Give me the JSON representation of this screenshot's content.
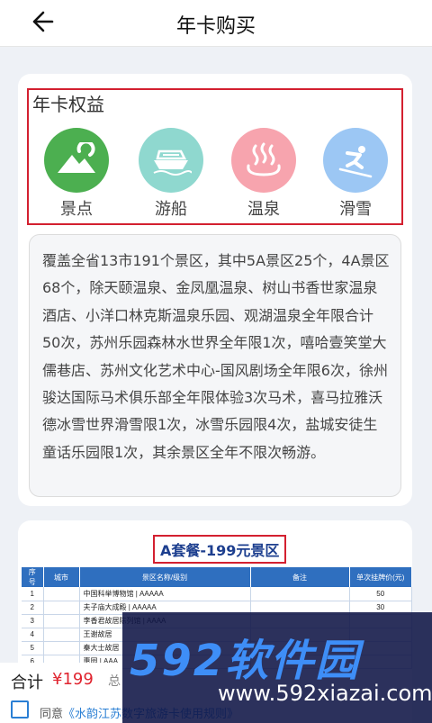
{
  "header": {
    "title": "年卡购买"
  },
  "benefits": {
    "title": "年卡权益",
    "items": [
      {
        "label": "景点",
        "icon": "mountain-icon",
        "color": "#4caf50"
      },
      {
        "label": "游船",
        "icon": "ship-icon",
        "color": "#8fd8cf"
      },
      {
        "label": "温泉",
        "icon": "hot-spring-icon",
        "color": "#f7a4ae"
      },
      {
        "label": "滑雪",
        "icon": "skiing-icon",
        "color": "#9cc7f4"
      }
    ],
    "description": "覆盖全省13市191个景区，其中5A景区25个，4A景区68个，除天颐温泉、金凤凰温泉、树山书香世家温泉酒店、小洋口林克斯温泉乐园、观湖温泉全年限合计50次，苏州乐园森林水世界全年限1次，嘻哈壹笑堂大儒巷店、苏州文化艺术中心-国风剧场全年限6次，徐州骏达国际马术俱乐部全年限体验3次马术，喜马拉雅沃德冰雪世界滑雪限1次，冰雪乐园限4次，盐城安徒生童话乐园限1次，其余景区全年不限次畅游。"
  },
  "package": {
    "title": "A套餐-199元景区",
    "columns": [
      "序号",
      "城市",
      "景区名称/级别",
      "备注",
      "单次挂牌价(元)"
    ],
    "rows": [
      [
        "1",
        "",
        "中国科举博物馆 | AAAAA",
        "",
        "50"
      ],
      [
        "2",
        "",
        "夫子庙大成殿 | AAAAA",
        "",
        "30"
      ],
      [
        "3",
        "",
        "李香君故居陈列馆 | AAAA",
        "",
        ""
      ],
      [
        "4",
        "",
        "王谢故居",
        "",
        ""
      ],
      [
        "5",
        "",
        "秦大士故居",
        "",
        ""
      ],
      [
        "6",
        "",
        "惠园 | AAA",
        "",
        ""
      ]
    ]
  },
  "watermark": {
    "logo": "592软件园",
    "url": "www.592xiazai.com"
  },
  "footer": {
    "total_label": "合计",
    "price": "¥199",
    "total_tail": "总",
    "agree_prefix": "同意",
    "agree_link": "《水韵江苏数字旅游卡使用规则》"
  }
}
